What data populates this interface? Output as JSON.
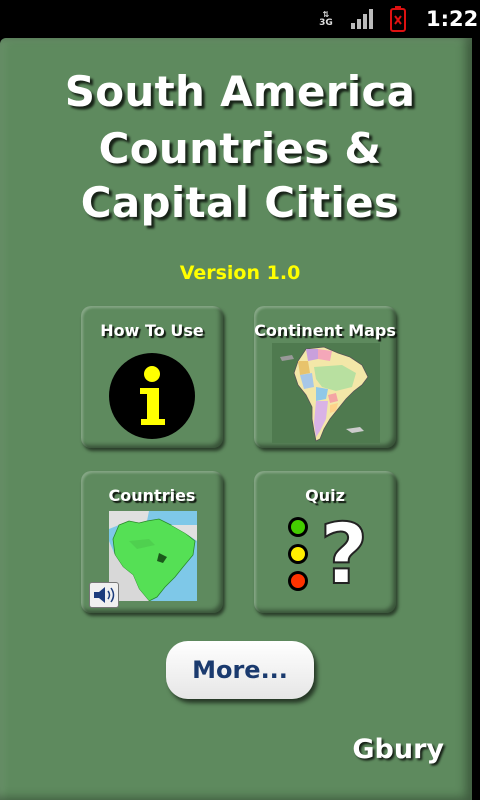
{
  "status_bar": {
    "network": "3G",
    "time": "1:22",
    "signal_icon": "signal-bars-icon",
    "battery_icon": "battery-alert-icon"
  },
  "app": {
    "title_line1": "South America",
    "title_line2": "Countries &",
    "title_line3": "Capital Cities",
    "version": "Version 1.0",
    "author": "Gbury"
  },
  "tiles": [
    {
      "label": "How To Use",
      "icon": "info-icon"
    },
    {
      "label": "Continent Maps",
      "icon": "south-america-map-icon"
    },
    {
      "label": "Countries",
      "icon": "brazil-map-icon"
    },
    {
      "label": "Quiz",
      "icon": "quiz-traffic-light-question-icon"
    }
  ],
  "more_button": {
    "label": "More..."
  },
  "colors": {
    "panel_background": "#5e8a5e",
    "version_text": "#ffff00",
    "more_text": "#1a3a6e"
  }
}
